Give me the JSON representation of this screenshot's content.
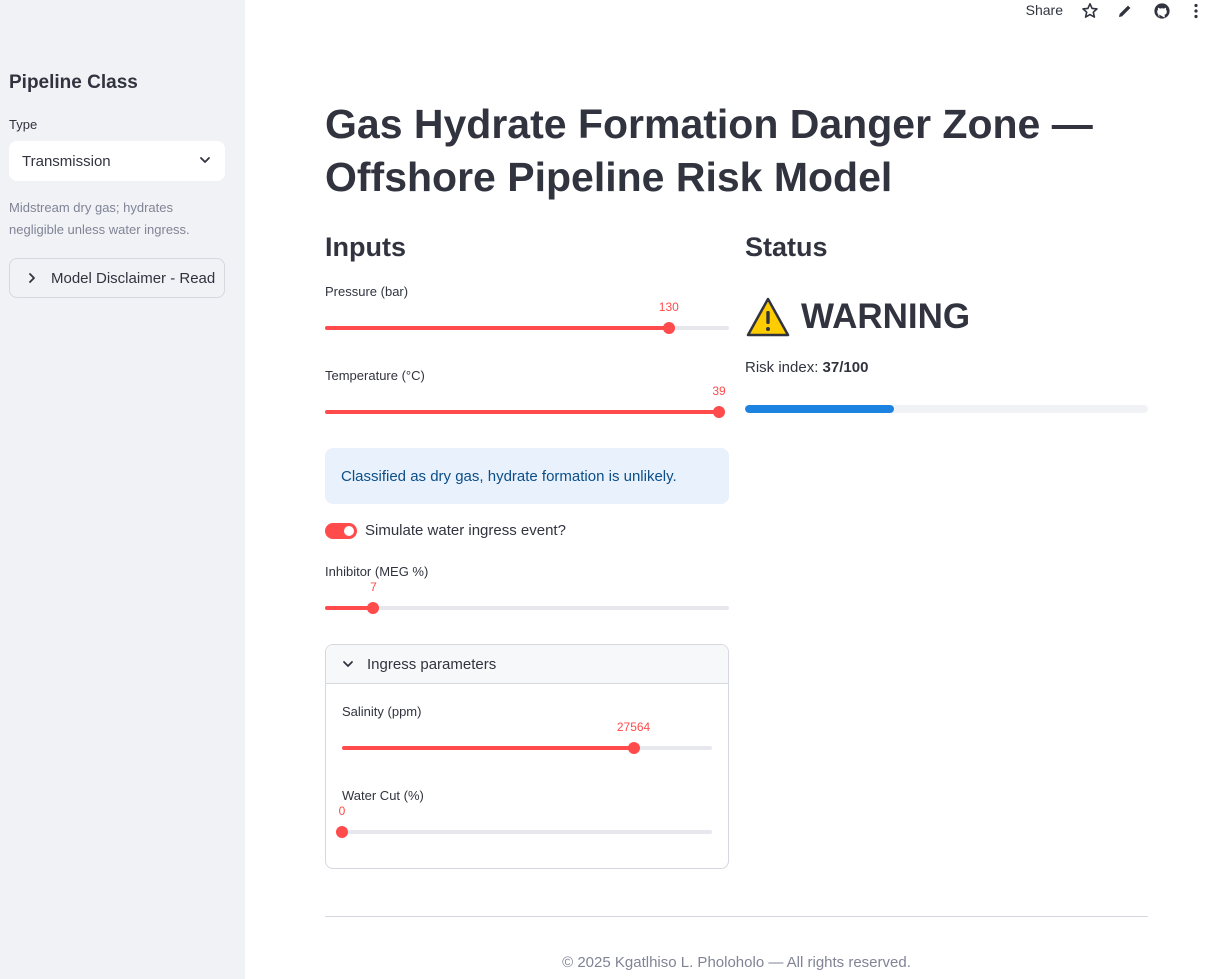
{
  "toolbar": {
    "share_label": "Share",
    "icons": [
      "star-icon",
      "pencil-icon",
      "github-icon",
      "more-vertical-icon"
    ]
  },
  "sidebar": {
    "title": "Pipeline Class",
    "type_label": "Type",
    "type_value": "Transmission",
    "help_text": "Midstream dry gas; hydrates negligible unless water ingress.",
    "disclaimer_label": "Model Disclaimer - Read"
  },
  "main": {
    "title": "Gas Hydrate Formation Danger Zone — Offshore Pipeline Risk Model",
    "inputs_heading": "Inputs",
    "status_heading": "Status"
  },
  "inputs": {
    "pressure": {
      "label": "Pressure (bar)",
      "value": "130",
      "fraction": 0.851
    },
    "temperature": {
      "label": "Temperature (°C)",
      "value": "39",
      "fraction": 1.0
    },
    "info_message": "Classified as dry gas, hydrate formation is unlikely.",
    "water_ingress": {
      "label": "Simulate water ingress event?",
      "checked": true
    },
    "inhibitor": {
      "label": "Inhibitor (MEG %)",
      "value": "7",
      "fraction": 0.12
    },
    "ingress": {
      "heading": "Ingress parameters",
      "salinity": {
        "label": "Salinity (ppm)",
        "value": "27564",
        "fraction": 0.788
      },
      "water_cut": {
        "label": "Water Cut (%)",
        "value": "0",
        "fraction": 0.0
      }
    }
  },
  "status": {
    "level": "WARNING",
    "risk_label": "Risk index: ",
    "risk_value": "37/100",
    "risk_fraction": 0.37,
    "accent_color": "#ff4b4b",
    "progress_color": "#1c83e1"
  },
  "footer": {
    "text": "© 2025 Kgatlhiso L. Pholoholo — All rights reserved."
  }
}
